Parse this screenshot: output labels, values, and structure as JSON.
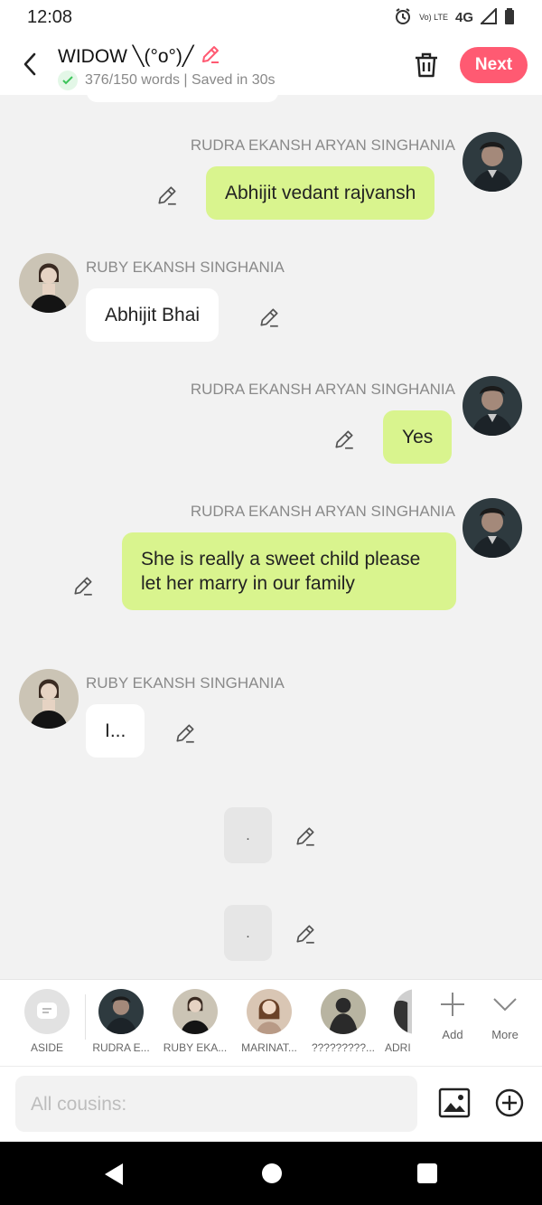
{
  "status_bar": {
    "time": "12:08",
    "volte": "Vo) LTE",
    "network": "4G",
    "icons": [
      "alarm-icon",
      "volte-icon",
      "signal-icon",
      "battery-icon"
    ]
  },
  "header": {
    "story_title": "WIDOW ╲(°o°)╱",
    "word_status": "376/150 words | Saved in 30s",
    "next_label": "Next",
    "accent_color": "#ff5a72"
  },
  "messages": [
    {
      "speaker": "RUDRA EKANSH ARYAN SINGHANIA",
      "text": "Abhijit vedant rajvansh",
      "side": "right"
    },
    {
      "speaker": "RUBY EKANSH SINGHANIA",
      "text": "Abhijit Bhai",
      "side": "left"
    },
    {
      "speaker": "RUDRA EKANSH ARYAN SINGHANIA",
      "text": "Yes",
      "side": "right"
    },
    {
      "speaker": "RUDRA EKANSH ARYAN SINGHANIA",
      "text": "She is really a sweet child please let her marry in our family",
      "side": "right"
    },
    {
      "speaker": "RUBY EKANSH SINGHANIA",
      "text": "I...",
      "side": "left"
    },
    {
      "speaker": "",
      "text": ".",
      "side": "aside"
    },
    {
      "speaker": "",
      "text": ".",
      "side": "aside"
    }
  ],
  "characters": [
    {
      "label": "ASIDE"
    },
    {
      "label": "RUDRA E..."
    },
    {
      "label": "RUBY EKA..."
    },
    {
      "label": "MARINAT..."
    },
    {
      "label": "?????????..."
    },
    {
      "label": "ADRI"
    }
  ],
  "bar_actions": {
    "add_label": "Add",
    "more_label": "More"
  },
  "input": {
    "placeholder": "All cousins:"
  },
  "colors": {
    "green_bubble": "#d9f48e",
    "background": "#f2f2f2"
  }
}
